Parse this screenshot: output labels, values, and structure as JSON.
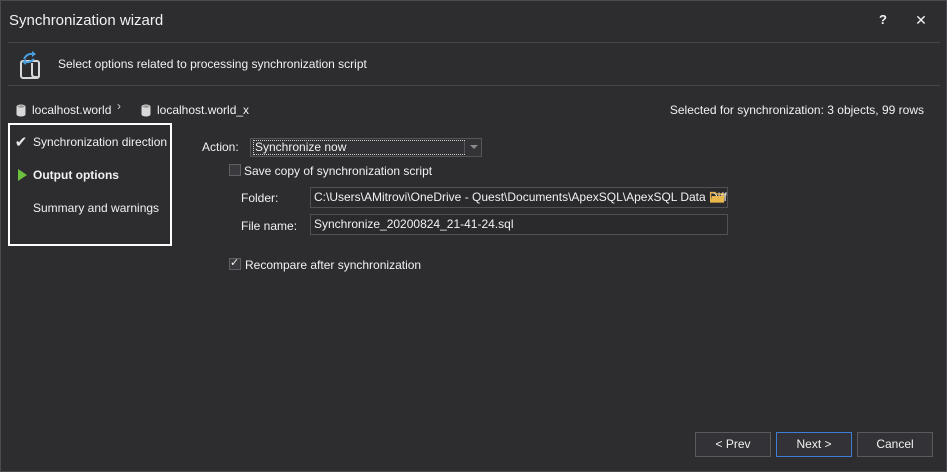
{
  "window": {
    "title": "Synchronization wizard",
    "help_label": "?",
    "close_label": "✕"
  },
  "header": {
    "text": "Select options related to processing synchronization script",
    "icon": "sync-script-icon"
  },
  "databases": {
    "source": "localhost.world",
    "separator": "›",
    "target": "localhost.world_x"
  },
  "selected_info": "Selected for synchronization: 3 objects, 99 rows",
  "steps": [
    {
      "label": "Synchronization direction",
      "state": "completed",
      "icon": "checkmark-icon"
    },
    {
      "label": "Output options",
      "state": "current",
      "icon": "play-arrow-icon"
    },
    {
      "label": "Summary and warnings",
      "state": "pending",
      "icon": ""
    }
  ],
  "form": {
    "action_label": "Action:",
    "action_value": "Synchronize now",
    "save_copy_label": "Save copy of synchronization script",
    "save_copy_checked": false,
    "folder_label": "Folder:",
    "folder_value": "C:\\Users\\AMitrovi\\OneDrive - Quest\\Documents\\ApexSQL\\ApexSQL Data Diff\\Exp",
    "file_name_label": "File name:",
    "file_name_value": "Synchronize_20200824_21-41-24.sql",
    "recompare_label": "Recompare after synchronization",
    "recompare_checked": true
  },
  "buttons": {
    "prev": "< Prev",
    "next": "Next >",
    "cancel": "Cancel"
  },
  "colors": {
    "background": "#2d2d30",
    "accent_green": "#6dbf3f",
    "focus_blue": "#3d7fd6",
    "folder_yellow": "#e8b64a",
    "icon_blue": "#4a9fe0"
  }
}
